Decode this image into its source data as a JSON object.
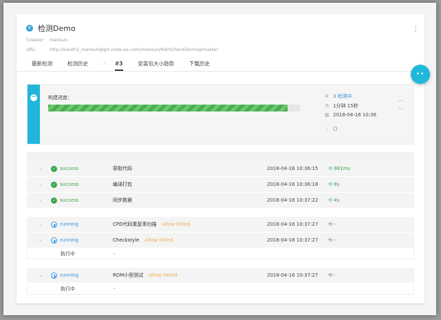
{
  "header": {
    "logo_glyph": "P",
    "title": "检测Demo",
    "menu_glyph": "⋮",
    "creator_label": "Creator:",
    "creator_value": "mansun",
    "url_label": "URL:",
    "url_value": "http://oauth2_mansun@git.code.oa.com/mansun/RdmCheckDemo@master"
  },
  "tabs": [
    {
      "label": "最新检测"
    },
    {
      "label": "检测历史"
    },
    {
      "label": "›"
    },
    {
      "label": "#3"
    },
    {
      "label": "安装包大小趋势"
    },
    {
      "label": "下载历史"
    }
  ],
  "fab_glyph": "••",
  "build": {
    "collapse_glyph": "−",
    "progress_label": "构建进度：",
    "progress_fraction": 0.95,
    "status": "3 检测中",
    "duration": "1分钟 15秒",
    "date": "2018-04-16 10:36",
    "more_glyph": "⋮",
    "clipboard_glyph": "▢",
    "up_glyph": "︿",
    "down_glyph": "﹀",
    "hash_glyph": "#",
    "clock_glyph": "◔",
    "calendar_glyph": "▦"
  },
  "colors": {
    "accent": "#21b5dc",
    "success": "#3aa34a",
    "running": "#2f8fdc",
    "warning": "#f0ad4e"
  },
  "stages": [
    {
      "status": "success",
      "name": "获取代码",
      "allow": "",
      "time": "2018-04-16 10:36:15",
      "duration": "981ms"
    },
    {
      "status": "success",
      "name": "编译打包",
      "allow": "",
      "time": "2018-04-16 10:36:18",
      "duration": "8s"
    },
    {
      "status": "success",
      "name": "同步数据",
      "allow": "",
      "time": "2018-04-16 10:37:22",
      "duration": "4s"
    },
    {
      "status": "running",
      "name": "CPD代码重复率扫描",
      "allow": "Allow Failed",
      "time": "2018-04-16 10:37:27",
      "duration": "-"
    },
    {
      "status": "running",
      "name": "Checkstyle",
      "allow": "Allow Failed",
      "time": "2018-04-16 10:37:27",
      "duration": "-",
      "detail_label": "执行中",
      "detail_value": "-"
    },
    {
      "status": "running",
      "name": "RDM小型测试",
      "allow": "Allow Failed",
      "time": "2018-04-16 10:37:27",
      "duration": "-",
      "detail_label": "执行中",
      "detail_value": "-"
    }
  ],
  "glyphs": {
    "chevron": "⌄",
    "check": "✓",
    "spin": "◑",
    "timer": "⟲"
  }
}
